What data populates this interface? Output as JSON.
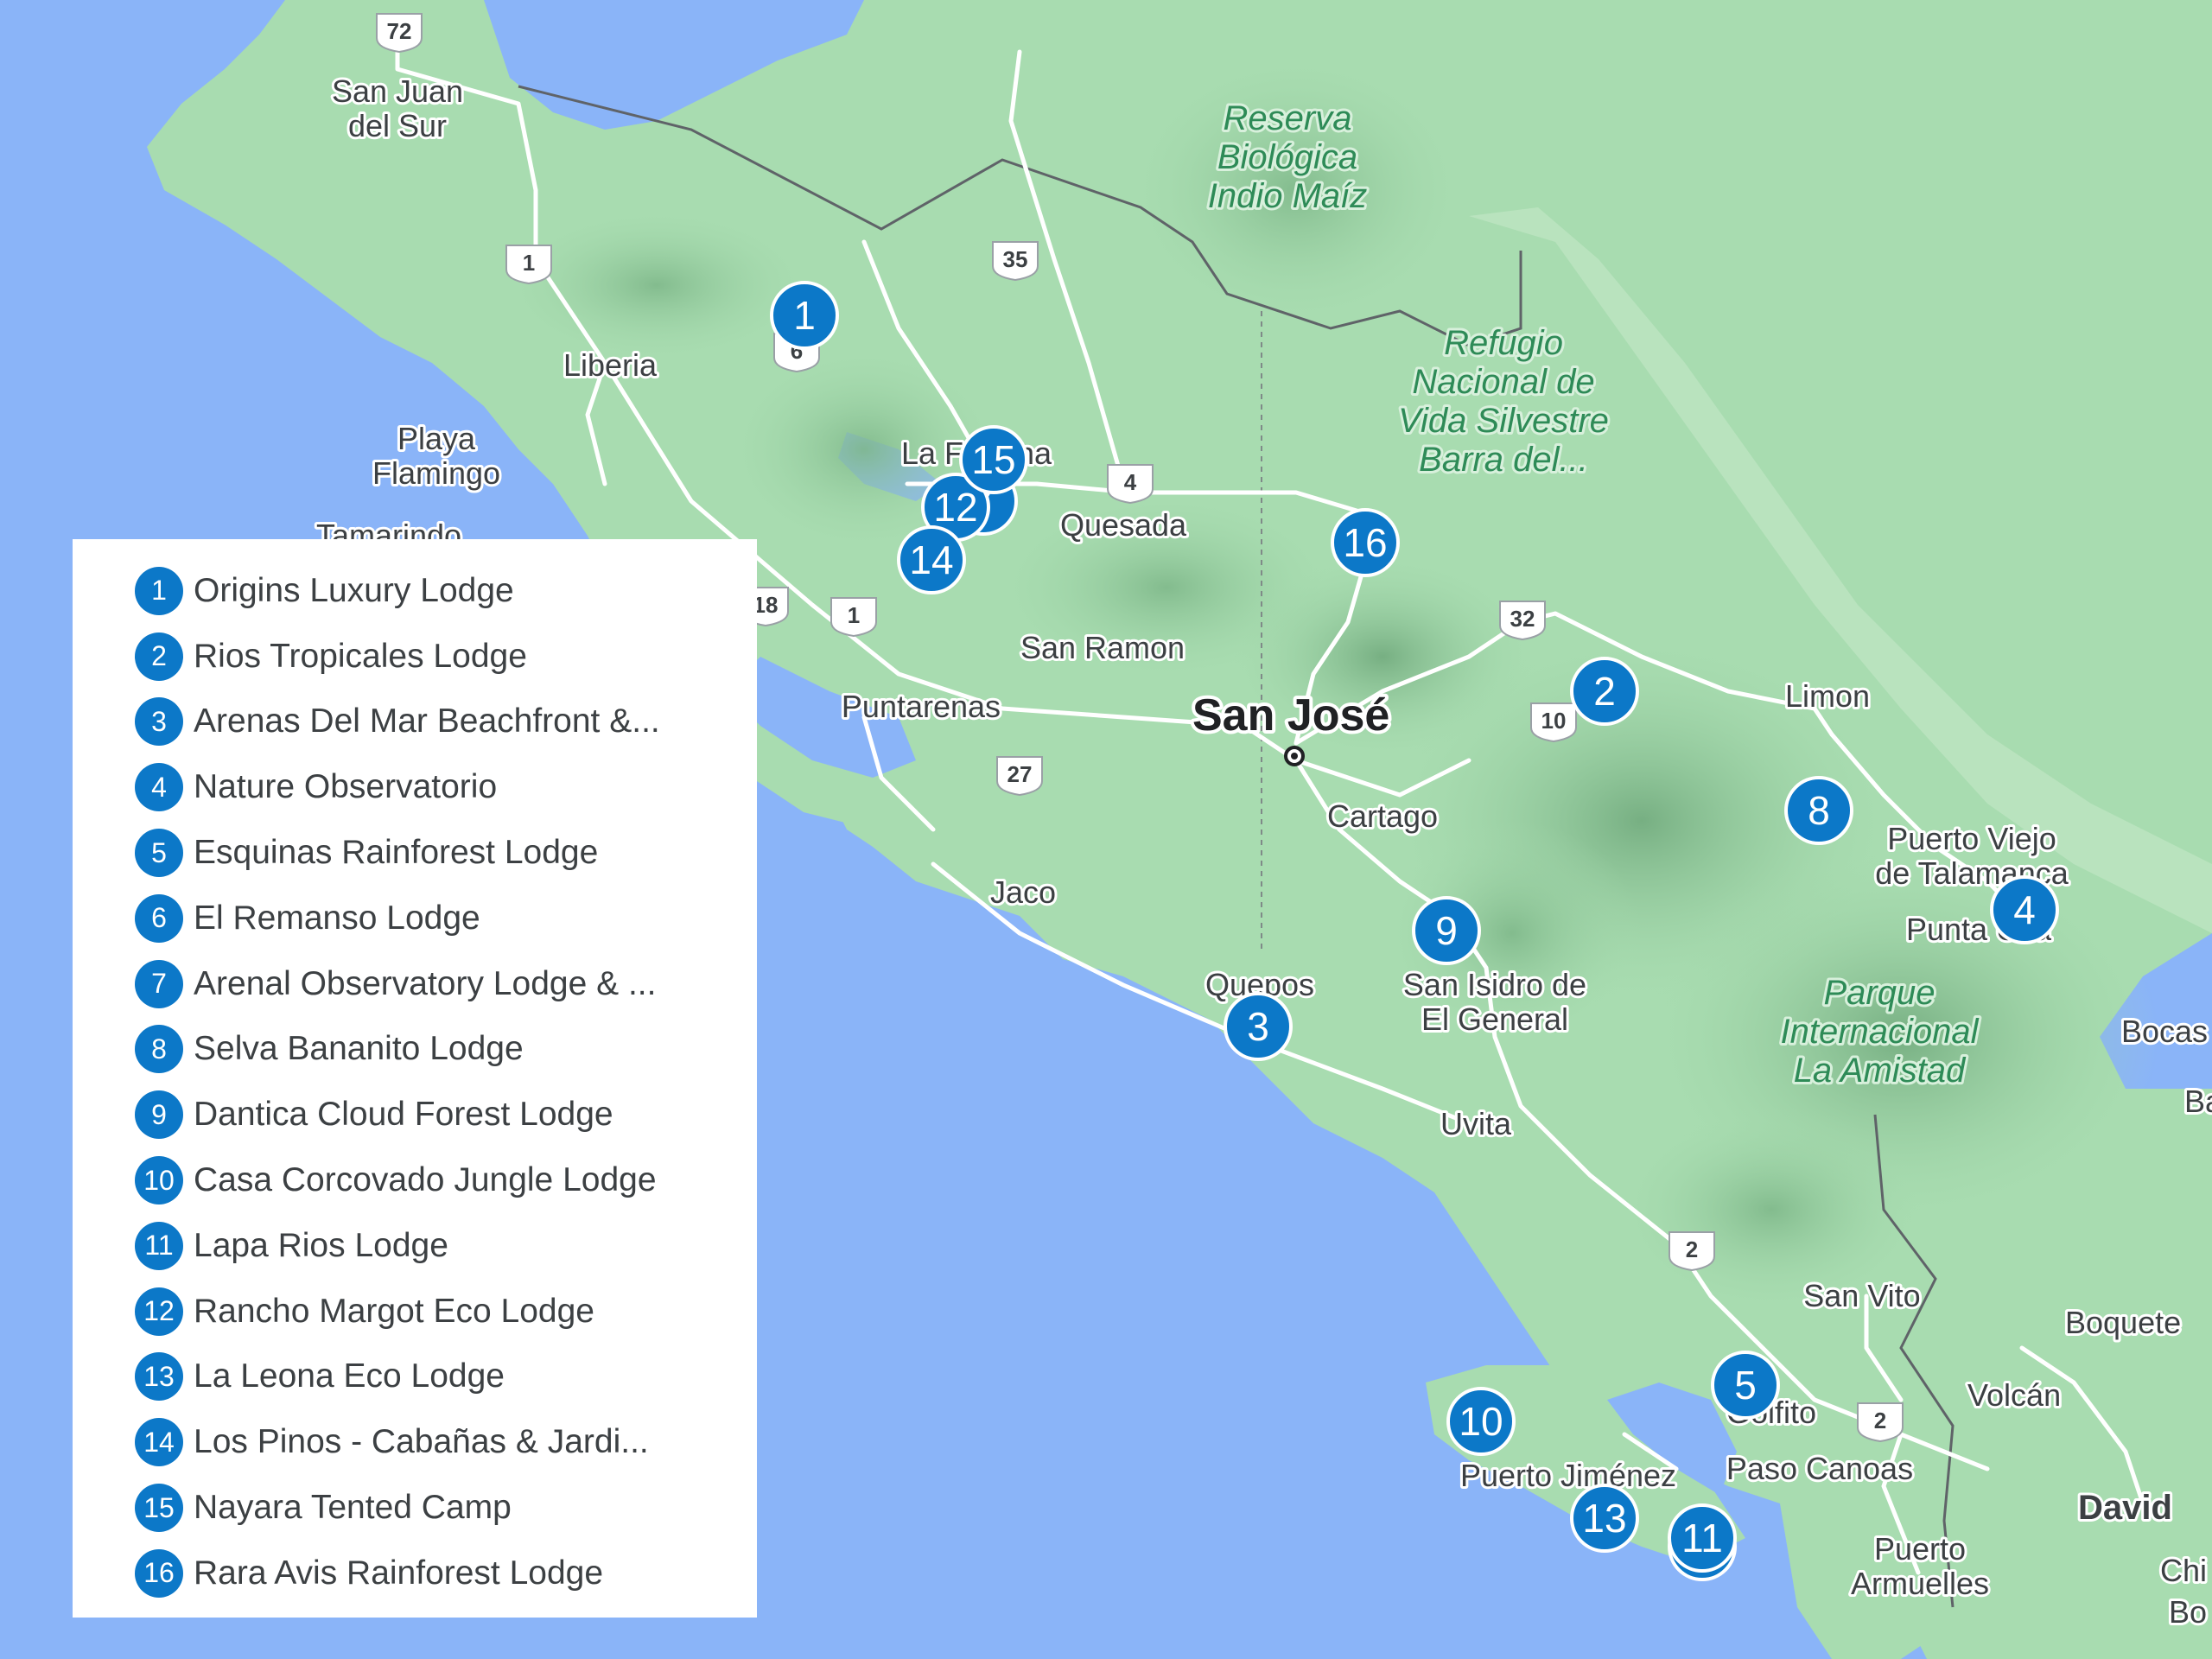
{
  "colors": {
    "water": "#8ab4f8",
    "land": "#a8dcb0",
    "marker": "#0c78c8",
    "border": "#5f6368"
  },
  "map": {
    "places": [
      {
        "id": "san-juan-del-sur",
        "lines": [
          "San Juan",
          "del Sur"
        ]
      },
      {
        "id": "liberia",
        "lines": [
          "Liberia"
        ]
      },
      {
        "id": "playa-flamingo",
        "lines": [
          "Playa",
          "Flamingo"
        ]
      },
      {
        "id": "tamarindo",
        "lines": [
          "Tamarindo"
        ]
      },
      {
        "id": "la-fortuna",
        "lines": [
          "La Fortuna"
        ]
      },
      {
        "id": "quesada",
        "lines": [
          "Quesada"
        ]
      },
      {
        "id": "san-ramon",
        "lines": [
          "San Ramon"
        ]
      },
      {
        "id": "puntarenas",
        "lines": [
          "Puntarenas"
        ]
      },
      {
        "id": "jaco",
        "lines": [
          "Jaco"
        ]
      },
      {
        "id": "quepos",
        "lines": [
          "Quepos"
        ]
      },
      {
        "id": "cartago",
        "lines": [
          "Cartago"
        ]
      },
      {
        "id": "san-isidro",
        "lines": [
          "San Isidro de",
          "El General"
        ]
      },
      {
        "id": "uvita",
        "lines": [
          "Uvita"
        ]
      },
      {
        "id": "limon",
        "lines": [
          "Limon"
        ]
      },
      {
        "id": "puerto-viejo",
        "lines": [
          "Puerto Viejo",
          "de Talamanca"
        ]
      },
      {
        "id": "punta-uva",
        "lines": [
          "Punta Uva"
        ]
      },
      {
        "id": "bocas",
        "lines": [
          "Bocas"
        ]
      },
      {
        "id": "ba",
        "lines": [
          "Ba"
        ]
      },
      {
        "id": "san-vito",
        "lines": [
          "San Vito"
        ]
      },
      {
        "id": "boquete",
        "lines": [
          "Boquete"
        ]
      },
      {
        "id": "volcan",
        "lines": [
          "Volcán"
        ]
      },
      {
        "id": "golfito",
        "lines": [
          "Golfito"
        ]
      },
      {
        "id": "paso-canoas",
        "lines": [
          "Paso Canoas"
        ]
      },
      {
        "id": "puerto-jimenez",
        "lines": [
          "Puerto Jiménez"
        ]
      },
      {
        "id": "puerto-armuelles",
        "lines": [
          "Puerto",
          "Armuelles"
        ]
      },
      {
        "id": "david",
        "lines": [
          "David"
        ]
      },
      {
        "id": "chi",
        "lines": [
          "Chi"
        ]
      },
      {
        "id": "bo",
        "lines": [
          "Bo"
        ]
      }
    ],
    "capital": "San José",
    "parks": [
      {
        "id": "indio-maiz",
        "lines": [
          "Reserva",
          "Biológica",
          "Indio Maíz"
        ]
      },
      {
        "id": "barra-del-colorado",
        "lines": [
          "Refugio",
          "Nacional de",
          "Vida Silvestre",
          "Barra del..."
        ]
      },
      {
        "id": "la-amistad",
        "lines": [
          "Parque",
          "Internacional",
          "La Amistad"
        ]
      }
    ],
    "road_shields": [
      "72",
      "1",
      "35",
      "6",
      "4",
      "1",
      "18",
      "32",
      "10",
      "27",
      "2",
      "2"
    ],
    "markers": [
      "1",
      "2",
      "3",
      "4",
      "5",
      "6",
      "7",
      "8",
      "9",
      "10",
      "11",
      "12",
      "13",
      "14",
      "15",
      "16"
    ]
  },
  "legend": {
    "items": [
      {
        "num": "1",
        "label": "Origins Luxury Lodge"
      },
      {
        "num": "2",
        "label": "Rios Tropicales Lodge"
      },
      {
        "num": "3",
        "label": "Arenas Del Mar Beachfront &..."
      },
      {
        "num": "4",
        "label": "Nature Observatorio"
      },
      {
        "num": "5",
        "label": "Esquinas Rainforest Lodge"
      },
      {
        "num": "6",
        "label": "El Remanso Lodge"
      },
      {
        "num": "7",
        "label": "Arenal Observatory Lodge & ..."
      },
      {
        "num": "8",
        "label": "Selva Bananito Lodge"
      },
      {
        "num": "9",
        "label": "Dantica Cloud Forest Lodge"
      },
      {
        "num": "10",
        "label": "Casa Corcovado Jungle Lodge"
      },
      {
        "num": "11",
        "label": "Lapa Rios Lodge"
      },
      {
        "num": "12",
        "label": "Rancho Margot Eco Lodge"
      },
      {
        "num": "13",
        "label": "La Leona Eco Lodge"
      },
      {
        "num": "14",
        "label": "Los Pinos - Cabañas & Jardi..."
      },
      {
        "num": "15",
        "label": "Nayara Tented Camp"
      },
      {
        "num": "16",
        "label": "Rara Avis Rainforest Lodge"
      }
    ]
  }
}
